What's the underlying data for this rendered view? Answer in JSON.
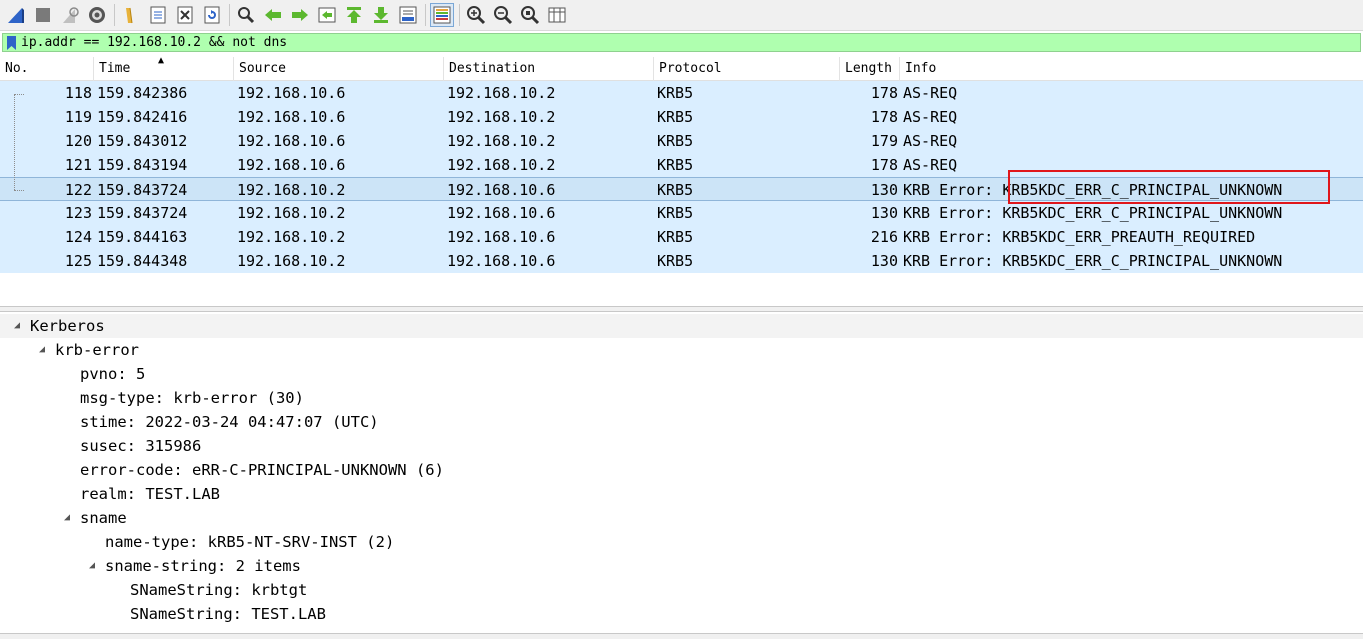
{
  "toolbar": {
    "buttons": [
      {
        "icon": "shark-fin-icon"
      },
      {
        "icon": "stop-square-icon"
      },
      {
        "icon": "restart-fin-icon"
      },
      {
        "icon": "gear-options-icon"
      },
      {
        "icon": "open-folder-icon"
      },
      {
        "icon": "save-file-icon"
      },
      {
        "icon": "close-file-icon"
      },
      {
        "icon": "reload-icon"
      },
      {
        "icon": "find-packet-icon"
      },
      {
        "icon": "go-back-arrow-icon"
      },
      {
        "icon": "go-forward-arrow-icon"
      },
      {
        "icon": "go-to-packet-icon"
      },
      {
        "icon": "first-packet-icon"
      },
      {
        "icon": "last-packet-icon"
      },
      {
        "icon": "auto-scroll-icon"
      },
      {
        "icon": "colorize-icon"
      },
      {
        "icon": "zoom-in-icon"
      },
      {
        "icon": "zoom-out-icon"
      },
      {
        "icon": "normal-size-icon"
      },
      {
        "icon": "resize-columns-icon"
      }
    ]
  },
  "filter": {
    "value": "ip.addr == 192.168.10.2 && not dns",
    "background": "#afffaf"
  },
  "packet_list": {
    "columns": [
      "No.",
      "Time",
      "Source",
      "Destination",
      "Protocol",
      "Length",
      "Info"
    ],
    "rows": [
      {
        "no": "118",
        "time": "159.842386",
        "src": "192.168.10.6",
        "dst": "192.168.10.2",
        "proto": "KRB5",
        "len": "178",
        "info": "AS-REQ"
      },
      {
        "no": "119",
        "time": "159.842416",
        "src": "192.168.10.6",
        "dst": "192.168.10.2",
        "proto": "KRB5",
        "len": "178",
        "info": "AS-REQ"
      },
      {
        "no": "120",
        "time": "159.843012",
        "src": "192.168.10.6",
        "dst": "192.168.10.2",
        "proto": "KRB5",
        "len": "179",
        "info": "AS-REQ"
      },
      {
        "no": "121",
        "time": "159.843194",
        "src": "192.168.10.6",
        "dst": "192.168.10.2",
        "proto": "KRB5",
        "len": "178",
        "info": "AS-REQ"
      },
      {
        "no": "122",
        "time": "159.843724",
        "src": "192.168.10.2",
        "dst": "192.168.10.6",
        "proto": "KRB5",
        "len": "130",
        "info": "KRB Error: KRB5KDC_ERR_C_PRINCIPAL_UNKNOWN",
        "selected": true
      },
      {
        "no": "123",
        "time": "159.843724",
        "src": "192.168.10.2",
        "dst": "192.168.10.6",
        "proto": "KRB5",
        "len": "130",
        "info": "KRB Error: KRB5KDC_ERR_C_PRINCIPAL_UNKNOWN"
      },
      {
        "no": "124",
        "time": "159.844163",
        "src": "192.168.10.2",
        "dst": "192.168.10.6",
        "proto": "KRB5",
        "len": "216",
        "info": "KRB Error: KRB5KDC_ERR_PREAUTH_REQUIRED"
      },
      {
        "no": "125",
        "time": "159.844348",
        "src": "192.168.10.2",
        "dst": "192.168.10.6",
        "proto": "KRB5",
        "len": "130",
        "info": "KRB Error: KRB5KDC_ERR_C_PRINCIPAL_UNKNOWN"
      }
    ],
    "row_color": "#daeeff",
    "highlight_color": "#e0161b"
  },
  "details": {
    "rows": [
      {
        "text": "Kerberos",
        "level": 0,
        "expanded": true
      },
      {
        "text": "krb-error",
        "level": 1,
        "expanded": true
      },
      {
        "text": "pvno: 5",
        "level": 2
      },
      {
        "text": "msg-type: krb-error (30)",
        "level": 2
      },
      {
        "text": "stime: 2022-03-24 04:47:07 (UTC)",
        "level": 2
      },
      {
        "text": "susec: 315986",
        "level": 2
      },
      {
        "text": "error-code: eRR-C-PRINCIPAL-UNKNOWN (6)",
        "level": 2
      },
      {
        "text": "realm: TEST.LAB",
        "level": 2
      },
      {
        "text": "sname",
        "level": 2,
        "expanded": true
      },
      {
        "text": "name-type: kRB5-NT-SRV-INST (2)",
        "level": 3
      },
      {
        "text": "sname-string: 2 items",
        "level": 3,
        "expanded": true
      },
      {
        "text": "SNameString: krbtgt",
        "level": 4
      },
      {
        "text": "SNameString: TEST.LAB",
        "level": 4
      }
    ]
  }
}
